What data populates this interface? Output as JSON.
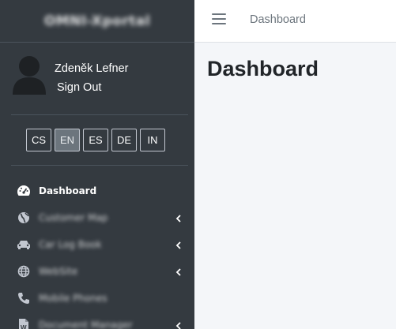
{
  "brand": {
    "name": "OMNI-Xportal"
  },
  "user": {
    "name": "Zdeněk Lefner",
    "sign_out": "Sign Out"
  },
  "languages": [
    {
      "code": "CS",
      "active": false
    },
    {
      "code": "EN",
      "active": true
    },
    {
      "code": "ES",
      "active": false
    },
    {
      "code": "DE",
      "active": false
    },
    {
      "code": "IN",
      "active": false
    }
  ],
  "nav": [
    {
      "label": "Dashboard",
      "icon": "tachometer-icon",
      "active": true,
      "has_submenu": false
    },
    {
      "label": "Customer Map",
      "icon": "globe-icon",
      "active": false,
      "has_submenu": true
    },
    {
      "label": "Car Log Book",
      "icon": "car-icon",
      "active": false,
      "has_submenu": true
    },
    {
      "label": "WebSite",
      "icon": "world-icon",
      "active": false,
      "has_submenu": true
    },
    {
      "label": "Mobile Phones",
      "icon": "phone-icon",
      "active": false,
      "has_submenu": false
    },
    {
      "label": "Document Manager",
      "icon": "word-document-icon",
      "active": false,
      "has_submenu": true
    }
  ],
  "header": {
    "breadcrumb": "Dashboard"
  },
  "main": {
    "title": "Dashboard"
  },
  "colors": {
    "sidebar_bg": "#343a40",
    "content_bg": "#f4f6f9",
    "header_bg": "#ffffff",
    "active_lang": "#6c757d"
  }
}
